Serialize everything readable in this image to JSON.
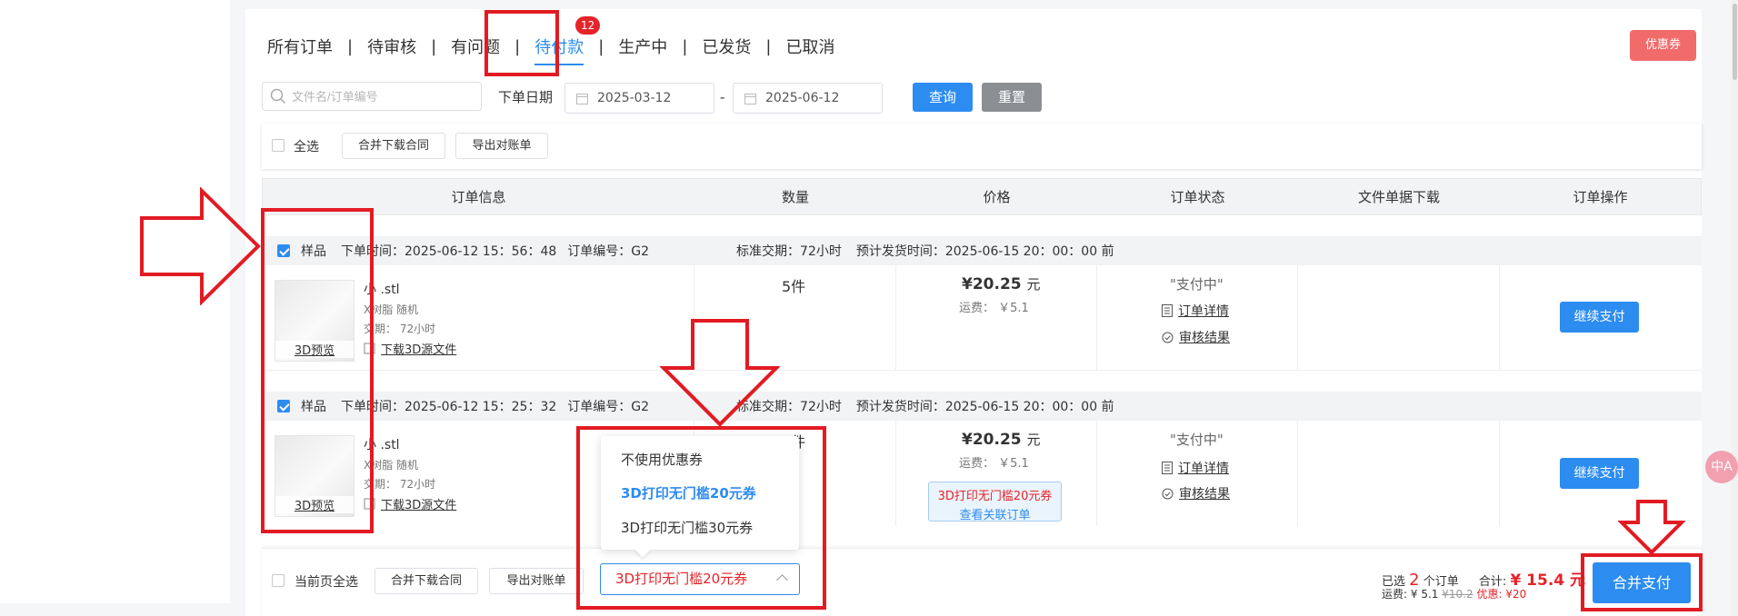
{
  "tabs": [
    {
      "label": "所有订单"
    },
    {
      "label": "待审核"
    },
    {
      "label": "有问题"
    },
    {
      "label": "待付款",
      "badge": "12",
      "active": true
    },
    {
      "label": "生产中"
    },
    {
      "label": "已发货"
    },
    {
      "label": "已取消"
    }
  ],
  "tab_separator": "|",
  "coupon_button": "优惠券",
  "filters": {
    "search_placeholder": "文件名/订单编号",
    "date_label": "下单日期",
    "date_from": "2025-03-12",
    "date_to": "2025-06-12",
    "date_sep": "-",
    "query": "查询",
    "reset": "重置"
  },
  "toolbar": {
    "select_all": "全选",
    "merge_contract": "合并下载合同",
    "export_bill": "导出对账单"
  },
  "columns": [
    "订单信息",
    "数量",
    "价格",
    "订单状态",
    "文件单据下载",
    "订单操作"
  ],
  "orders": [
    {
      "sample": "样品",
      "order_time": "下单时间：2025-06-12 15：56：48",
      "order_no": "订单编号：G2",
      "standard_delivery": "标准交期：72小时",
      "ship_eta": "预计发货时间：2025-06-15 20：00：00 前",
      "file_name": "小 .stl",
      "material": "X树脂 随机",
      "lead": "交期： 72小时",
      "preview": "3D预览",
      "download": "下载3D源文件",
      "qty": "5件",
      "price": "¥20.25",
      "price_unit": "元",
      "shipping": "运费： ￥5.1",
      "status": "\"支付中\"",
      "detail": "订单详情",
      "review": "审核结果",
      "pay_button": "继续支付"
    },
    {
      "sample": "样品",
      "order_time": "下单时间：2025-06-12 15：25：32",
      "order_no": "订单编号：G2",
      "standard_delivery": "标准交期：72小时",
      "ship_eta": "预计发货时间：2025-06-15 20：00：00 前",
      "file_name": "小 .stl",
      "material": "X树脂 随机",
      "lead": "交期： 72小时",
      "preview": "3D预览",
      "download": "下载3D源文件",
      "qty": "5件",
      "price": "¥20.25",
      "price_unit": "元",
      "shipping": "运费： ￥5.1",
      "status": "\"支付中\"",
      "detail": "订单详情",
      "review": "审核结果",
      "coupon_applied": "3D打印无门槛20元券",
      "view_linked": "查看关联订单",
      "pay_button": "继续支付"
    }
  ],
  "coupon_dropdown": {
    "options": [
      "不使用优惠券",
      "3D打印无门槛20元券",
      "3D打印无门槛30元券"
    ],
    "selected": "3D打印无门槛20元券"
  },
  "footer": {
    "select_page": "当前页全选",
    "merge_contract": "合并下载合同",
    "export_bill": "导出对账单",
    "selected_prefix": "已选",
    "selected_count": "2",
    "selected_suffix": "个订单",
    "total_label": "合计:",
    "total_value": "¥ 15.4 元",
    "shipping_label": "运费:",
    "shipping_value": "¥ 5.1",
    "original_price": "¥10.2",
    "discount_label": "优惠:",
    "discount_value": "¥20",
    "merge_pay": "合并支付"
  },
  "translate_fab": "中A",
  "colors": {
    "primary": "#2d8cf0",
    "danger": "#e4242a",
    "coupon": "#f16b6b",
    "annotation": "#e21b23"
  }
}
